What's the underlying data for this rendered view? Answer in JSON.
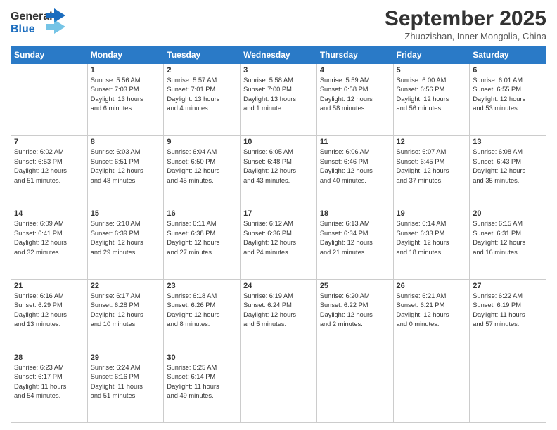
{
  "header": {
    "logo_line1": "General",
    "logo_line2": "Blue",
    "month_title": "September 2025",
    "location": "Zhuozishan, Inner Mongolia, China"
  },
  "days_of_week": [
    "Sunday",
    "Monday",
    "Tuesday",
    "Wednesday",
    "Thursday",
    "Friday",
    "Saturday"
  ],
  "weeks": [
    [
      {
        "day": "",
        "info": ""
      },
      {
        "day": "1",
        "info": "Sunrise: 5:56 AM\nSunset: 7:03 PM\nDaylight: 13 hours\nand 6 minutes."
      },
      {
        "day": "2",
        "info": "Sunrise: 5:57 AM\nSunset: 7:01 PM\nDaylight: 13 hours\nand 4 minutes."
      },
      {
        "day": "3",
        "info": "Sunrise: 5:58 AM\nSunset: 7:00 PM\nDaylight: 13 hours\nand 1 minute."
      },
      {
        "day": "4",
        "info": "Sunrise: 5:59 AM\nSunset: 6:58 PM\nDaylight: 12 hours\nand 58 minutes."
      },
      {
        "day": "5",
        "info": "Sunrise: 6:00 AM\nSunset: 6:56 PM\nDaylight: 12 hours\nand 56 minutes."
      },
      {
        "day": "6",
        "info": "Sunrise: 6:01 AM\nSunset: 6:55 PM\nDaylight: 12 hours\nand 53 minutes."
      }
    ],
    [
      {
        "day": "7",
        "info": "Sunrise: 6:02 AM\nSunset: 6:53 PM\nDaylight: 12 hours\nand 51 minutes."
      },
      {
        "day": "8",
        "info": "Sunrise: 6:03 AM\nSunset: 6:51 PM\nDaylight: 12 hours\nand 48 minutes."
      },
      {
        "day": "9",
        "info": "Sunrise: 6:04 AM\nSunset: 6:50 PM\nDaylight: 12 hours\nand 45 minutes."
      },
      {
        "day": "10",
        "info": "Sunrise: 6:05 AM\nSunset: 6:48 PM\nDaylight: 12 hours\nand 43 minutes."
      },
      {
        "day": "11",
        "info": "Sunrise: 6:06 AM\nSunset: 6:46 PM\nDaylight: 12 hours\nand 40 minutes."
      },
      {
        "day": "12",
        "info": "Sunrise: 6:07 AM\nSunset: 6:45 PM\nDaylight: 12 hours\nand 37 minutes."
      },
      {
        "day": "13",
        "info": "Sunrise: 6:08 AM\nSunset: 6:43 PM\nDaylight: 12 hours\nand 35 minutes."
      }
    ],
    [
      {
        "day": "14",
        "info": "Sunrise: 6:09 AM\nSunset: 6:41 PM\nDaylight: 12 hours\nand 32 minutes."
      },
      {
        "day": "15",
        "info": "Sunrise: 6:10 AM\nSunset: 6:39 PM\nDaylight: 12 hours\nand 29 minutes."
      },
      {
        "day": "16",
        "info": "Sunrise: 6:11 AM\nSunset: 6:38 PM\nDaylight: 12 hours\nand 27 minutes."
      },
      {
        "day": "17",
        "info": "Sunrise: 6:12 AM\nSunset: 6:36 PM\nDaylight: 12 hours\nand 24 minutes."
      },
      {
        "day": "18",
        "info": "Sunrise: 6:13 AM\nSunset: 6:34 PM\nDaylight: 12 hours\nand 21 minutes."
      },
      {
        "day": "19",
        "info": "Sunrise: 6:14 AM\nSunset: 6:33 PM\nDaylight: 12 hours\nand 18 minutes."
      },
      {
        "day": "20",
        "info": "Sunrise: 6:15 AM\nSunset: 6:31 PM\nDaylight: 12 hours\nand 16 minutes."
      }
    ],
    [
      {
        "day": "21",
        "info": "Sunrise: 6:16 AM\nSunset: 6:29 PM\nDaylight: 12 hours\nand 13 minutes."
      },
      {
        "day": "22",
        "info": "Sunrise: 6:17 AM\nSunset: 6:28 PM\nDaylight: 12 hours\nand 10 minutes."
      },
      {
        "day": "23",
        "info": "Sunrise: 6:18 AM\nSunset: 6:26 PM\nDaylight: 12 hours\nand 8 minutes."
      },
      {
        "day": "24",
        "info": "Sunrise: 6:19 AM\nSunset: 6:24 PM\nDaylight: 12 hours\nand 5 minutes."
      },
      {
        "day": "25",
        "info": "Sunrise: 6:20 AM\nSunset: 6:22 PM\nDaylight: 12 hours\nand 2 minutes."
      },
      {
        "day": "26",
        "info": "Sunrise: 6:21 AM\nSunset: 6:21 PM\nDaylight: 12 hours\nand 0 minutes."
      },
      {
        "day": "27",
        "info": "Sunrise: 6:22 AM\nSunset: 6:19 PM\nDaylight: 11 hours\nand 57 minutes."
      }
    ],
    [
      {
        "day": "28",
        "info": "Sunrise: 6:23 AM\nSunset: 6:17 PM\nDaylight: 11 hours\nand 54 minutes."
      },
      {
        "day": "29",
        "info": "Sunrise: 6:24 AM\nSunset: 6:16 PM\nDaylight: 11 hours\nand 51 minutes."
      },
      {
        "day": "30",
        "info": "Sunrise: 6:25 AM\nSunset: 6:14 PM\nDaylight: 11 hours\nand 49 minutes."
      },
      {
        "day": "",
        "info": ""
      },
      {
        "day": "",
        "info": ""
      },
      {
        "day": "",
        "info": ""
      },
      {
        "day": "",
        "info": ""
      }
    ]
  ]
}
